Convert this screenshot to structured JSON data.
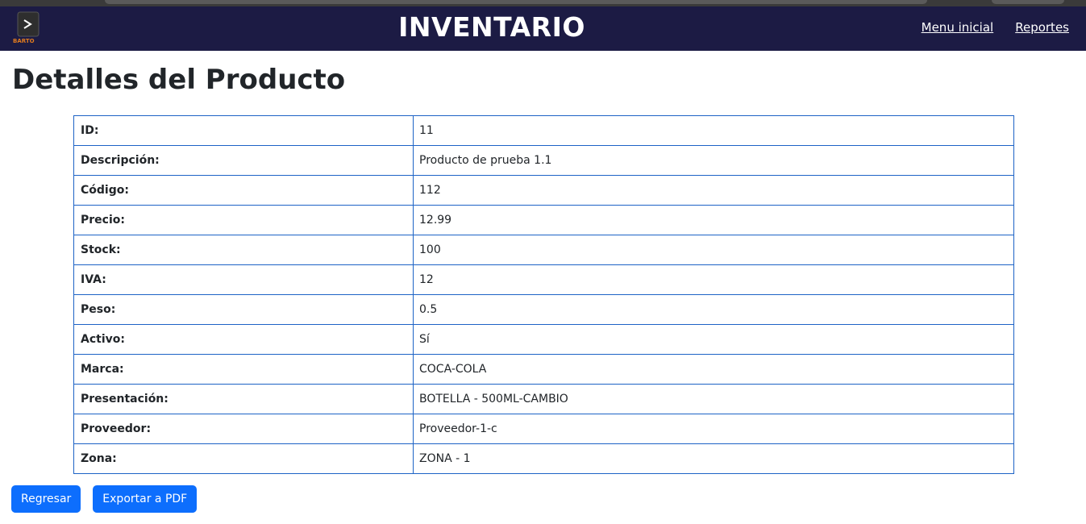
{
  "navbar": {
    "title": "INVENTARIO",
    "logo_text": "BARTO",
    "links": [
      "Menu inicial",
      "Reportes"
    ]
  },
  "page": {
    "title": "Detalles del Producto"
  },
  "details": [
    {
      "label": "ID:",
      "value": "11"
    },
    {
      "label": "Descripción:",
      "value": "Producto de prueba 1.1"
    },
    {
      "label": "Código:",
      "value": "112"
    },
    {
      "label": "Precio:",
      "value": "12.99"
    },
    {
      "label": "Stock:",
      "value": "100"
    },
    {
      "label": "IVA:",
      "value": "12"
    },
    {
      "label": "Peso:",
      "value": "0.5"
    },
    {
      "label": "Activo:",
      "value": "Sí"
    },
    {
      "label": "Marca:",
      "value": "COCA-COLA"
    },
    {
      "label": "Presentación:",
      "value": "BOTELLA - 500ML-CAMBIO"
    },
    {
      "label": "Proveedor:",
      "value": "Proveedor-1-c"
    },
    {
      "label": "Zona:",
      "value": "ZONA - 1"
    }
  ],
  "actions": {
    "back_label": "Regresar",
    "export_label": "Exportar a PDF"
  },
  "colors": {
    "navbar_bg": "#1c1b44",
    "table_border": "#1d63c6",
    "button_bg": "#0d6efd",
    "logo_accent": "#e07b1f"
  }
}
